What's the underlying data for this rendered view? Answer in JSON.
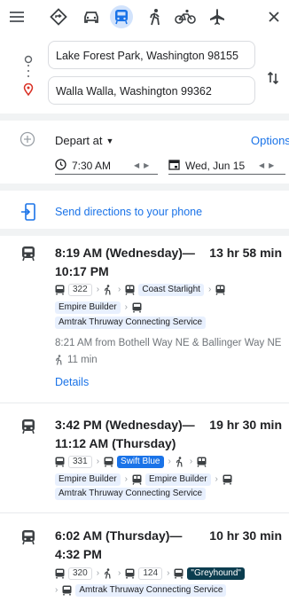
{
  "modes": [
    {
      "name": "best",
      "selected": false
    },
    {
      "name": "car",
      "selected": false
    },
    {
      "name": "transit",
      "selected": true
    },
    {
      "name": "walking",
      "selected": false
    },
    {
      "name": "cycling",
      "selected": false
    },
    {
      "name": "flight",
      "selected": false
    }
  ],
  "origin": "Lake Forest Park, Washington 98155",
  "destination": "Walla Walla, Washington 99362",
  "depart": {
    "label": "Depart at",
    "time": "7:30 AM",
    "date": "Wed, Jun 15",
    "options_label": "Options"
  },
  "send_directions": "Send directions to your phone",
  "routes": [
    {
      "title": "8:19 AM (Wednesday)—10:17 PM",
      "duration": "13 hr 58 min",
      "line1": {
        "bus_num": "322",
        "rail": "Coast Starlight"
      },
      "line2": {
        "rail": "Empire Builder"
      },
      "line3": {
        "bus": "Amtrak Thruway Connecting Service"
      },
      "from": "8:21 AM from Bothell Way NE & Ballinger Way NE",
      "walk": "11 min",
      "details_label": "Details"
    },
    {
      "title": "3:42 PM (Wednesday)—11:12 AM (Thursday)",
      "duration": "19 hr 30 min",
      "line1": {
        "bus_num": "331",
        "bus": "Swift Blue"
      },
      "line2": {
        "rail1": "Empire Builder",
        "rail2": "Empire Builder"
      },
      "line3": {
        "bus": "Amtrak Thruway Connecting Service"
      }
    },
    {
      "title": "6:02 AM (Thursday)—4:32 PM",
      "duration": "10 hr 30 min",
      "line1": {
        "bus_num1": "320",
        "bus_num2": "124",
        "bus": "\"Greyhound\""
      },
      "line2": {
        "bus": "Amtrak Thruway Connecting Service"
      }
    }
  ],
  "colors": {
    "accent": "#1a73e8",
    "chip": "#e8f0fe",
    "swift_blue": "#1a73e8",
    "greyhound": "#0b3d4f"
  }
}
